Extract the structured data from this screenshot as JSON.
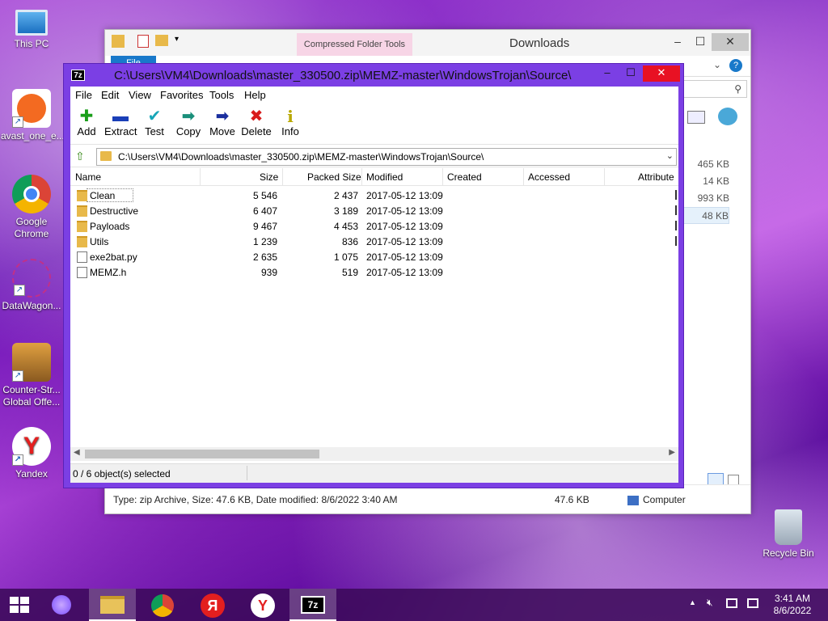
{
  "desktop": {
    "icons": [
      {
        "label": "This PC"
      },
      {
        "label": "avast_one_e..."
      },
      {
        "label": "Google Chrome"
      },
      {
        "label": "DataWagon..."
      },
      {
        "label": "Counter-Str... Global Offe..."
      },
      {
        "label": "Yandex"
      },
      {
        "label": "Recycle Bin"
      }
    ]
  },
  "explorer": {
    "context_tab": "Compressed Folder Tools",
    "title": "Downloads",
    "file_tab": "File",
    "side_sizes": [
      "465 KB",
      "14 KB",
      "993 KB",
      "48 KB"
    ],
    "status_text": "Type: zip Archive, Size: 47.6 KB, Date modified: 8/6/2022 3:40 AM",
    "status_size": "47.6 KB",
    "status_location": "Computer"
  },
  "sevenzip": {
    "title": "C:\\Users\\VM4\\Downloads\\master_330500.zip\\MEMZ-master\\WindowsTrojan\\Source\\",
    "menu": [
      "File",
      "Edit",
      "View",
      "Favorites",
      "Tools",
      "Help"
    ],
    "toolbar": [
      {
        "label": "Add",
        "icon": "add-icon",
        "glyph": "✚",
        "color": "#1a9e1a"
      },
      {
        "label": "Extract",
        "icon": "extract-icon",
        "glyph": "▬",
        "color": "#1a3fb8"
      },
      {
        "label": "Test",
        "icon": "test-icon",
        "glyph": "✔",
        "color": "#18a6b8"
      },
      {
        "label": "Copy",
        "icon": "copy-icon",
        "glyph": "➡",
        "color": "#1a8f7a"
      },
      {
        "label": "Move",
        "icon": "move-icon",
        "glyph": "➡",
        "color": "#1a2f9e"
      },
      {
        "label": "Delete",
        "icon": "delete-icon",
        "glyph": "✖",
        "color": "#d81b1b"
      },
      {
        "label": "Info",
        "icon": "info-icon",
        "glyph": "i",
        "color": "#b8a800"
      }
    ],
    "address": "C:\\Users\\VM4\\Downloads\\master_330500.zip\\MEMZ-master\\WindowsTrojan\\Source\\",
    "columns": [
      "Name",
      "Size",
      "Packed Size",
      "Modified",
      "Created",
      "Accessed",
      "Attribute"
    ],
    "rows": [
      {
        "name": "Clean",
        "type": "folder",
        "size": "5 546",
        "packed": "2 437",
        "modified": "2017-05-12 13:09"
      },
      {
        "name": "Destructive",
        "type": "folder",
        "size": "6 407",
        "packed": "3 189",
        "modified": "2017-05-12 13:09"
      },
      {
        "name": "Payloads",
        "type": "folder",
        "size": "9 467",
        "packed": "4 453",
        "modified": "2017-05-12 13:09"
      },
      {
        "name": "Utils",
        "type": "folder",
        "size": "1 239",
        "packed": "836",
        "modified": "2017-05-12 13:09"
      },
      {
        "name": "exe2bat.py",
        "type": "file",
        "size": "2 635",
        "packed": "1 075",
        "modified": "2017-05-12 13:09"
      },
      {
        "name": "MEMZ.h",
        "type": "file",
        "size": "939",
        "packed": "519",
        "modified": "2017-05-12 13:09"
      }
    ],
    "status": "0 / 6 object(s) selected"
  },
  "taskbar": {
    "clock_time": "3:41 AM",
    "clock_date": "8/6/2022",
    "pinned": [
      "start-button",
      "alice-button",
      "file-explorer",
      "chrome",
      "yandex-browser-red",
      "yandex",
      "7zip"
    ]
  }
}
